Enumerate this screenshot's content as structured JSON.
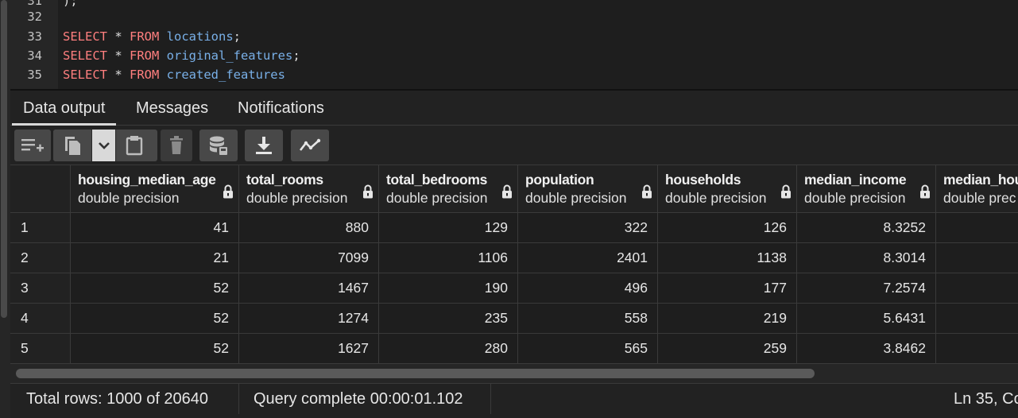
{
  "editor": {
    "lines": [
      {
        "num": "31",
        "kw1": "",
        "star": "",
        "kw2": "",
        "table": "",
        "tail": ");"
      },
      {
        "num": "32",
        "kw1": "",
        "star": "",
        "kw2": "",
        "table": "",
        "tail": ""
      },
      {
        "num": "33",
        "kw1": "SELECT",
        "star": " * ",
        "kw2": "FROM",
        "table": " locations",
        "tail": ";"
      },
      {
        "num": "34",
        "kw1": "SELECT",
        "star": " * ",
        "kw2": "FROM",
        "table": " original_features",
        "tail": ";"
      },
      {
        "num": "35",
        "kw1": "SELECT",
        "star": " * ",
        "kw2": "FROM",
        "table": " created_features",
        "tail": ""
      }
    ]
  },
  "tabs": {
    "data_output": "Data output",
    "messages": "Messages",
    "notifications": "Notifications",
    "active": "data_output"
  },
  "toolbar": {
    "icons": [
      "add-row-icon",
      "copy-icon",
      "chevron-down-icon",
      "paste-icon",
      "delete-icon",
      "save-data-icon",
      "download-icon",
      "graph-visualiser-icon"
    ]
  },
  "grid": {
    "columns": [
      {
        "name": "housing_median_age",
        "type": "double precision"
      },
      {
        "name": "total_rooms",
        "type": "double precision"
      },
      {
        "name": "total_bedrooms",
        "type": "double precision"
      },
      {
        "name": "population",
        "type": "double precision"
      },
      {
        "name": "households",
        "type": "double precision"
      },
      {
        "name": "median_income",
        "type": "double precision"
      },
      {
        "name": "median_hou",
        "type": "double prec"
      }
    ],
    "rows": [
      {
        "n": "1",
        "values": [
          "41",
          "880",
          "129",
          "322",
          "126",
          "8.3252",
          ""
        ]
      },
      {
        "n": "2",
        "values": [
          "21",
          "7099",
          "1106",
          "2401",
          "1138",
          "8.3014",
          ""
        ]
      },
      {
        "n": "3",
        "values": [
          "52",
          "1467",
          "190",
          "496",
          "177",
          "7.2574",
          ""
        ]
      },
      {
        "n": "4",
        "values": [
          "52",
          "1274",
          "235",
          "558",
          "219",
          "5.6431",
          ""
        ]
      },
      {
        "n": "5",
        "values": [
          "52",
          "1627",
          "280",
          "565",
          "259",
          "3.8462",
          ""
        ]
      }
    ]
  },
  "status": {
    "total_rows": "Total rows: 1000 of 20640",
    "query": "Query complete 00:00:01.102",
    "position": "Ln 35, Co"
  },
  "colors": {
    "keyword": "#ff7f7f",
    "identifier": "#79b0e8",
    "background": "#1e1e1e"
  }
}
